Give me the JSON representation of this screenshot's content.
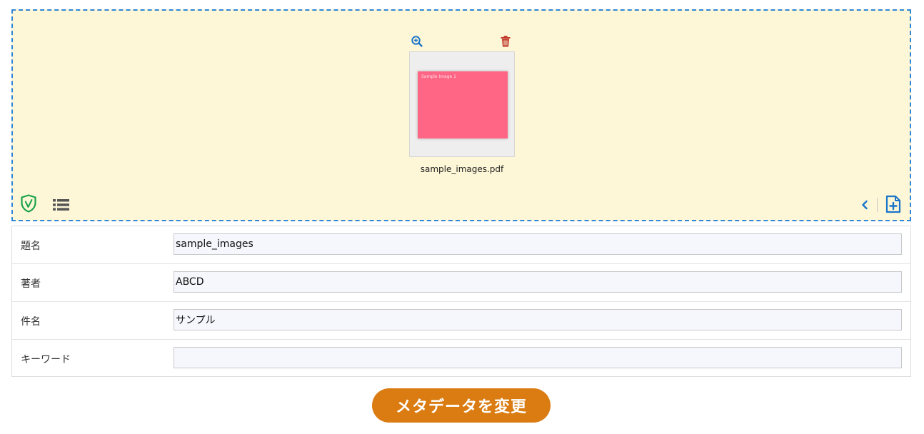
{
  "dropzone": {
    "file": {
      "name": "sample_images.pdf",
      "thumbnail_caption": "Sample Image 1",
      "thumbnail_color": "#ff6584"
    }
  },
  "metadata": {
    "rows": [
      {
        "label": "題名",
        "value": "sample_images"
      },
      {
        "label": "著者",
        "value": "ABCD"
      },
      {
        "label": "件名",
        "value": "サンプル"
      },
      {
        "label": "キーワード",
        "value": ""
      }
    ]
  },
  "submit": {
    "label": "メタデータを変更"
  },
  "colors": {
    "dropzone_bg": "#fdf7d7",
    "dropzone_border": "#2f86d6",
    "accent_blue": "#1b75c9",
    "trash_red": "#c0392b",
    "shield_green": "#1aa34a",
    "submit_orange": "#da7c12"
  },
  "icons": {
    "zoom": "zoom-in-icon",
    "trash": "trash-icon",
    "shield": "shield-check-icon",
    "list": "list-icon",
    "collapse": "chevron-left-icon",
    "add_file": "file-plus-icon"
  }
}
